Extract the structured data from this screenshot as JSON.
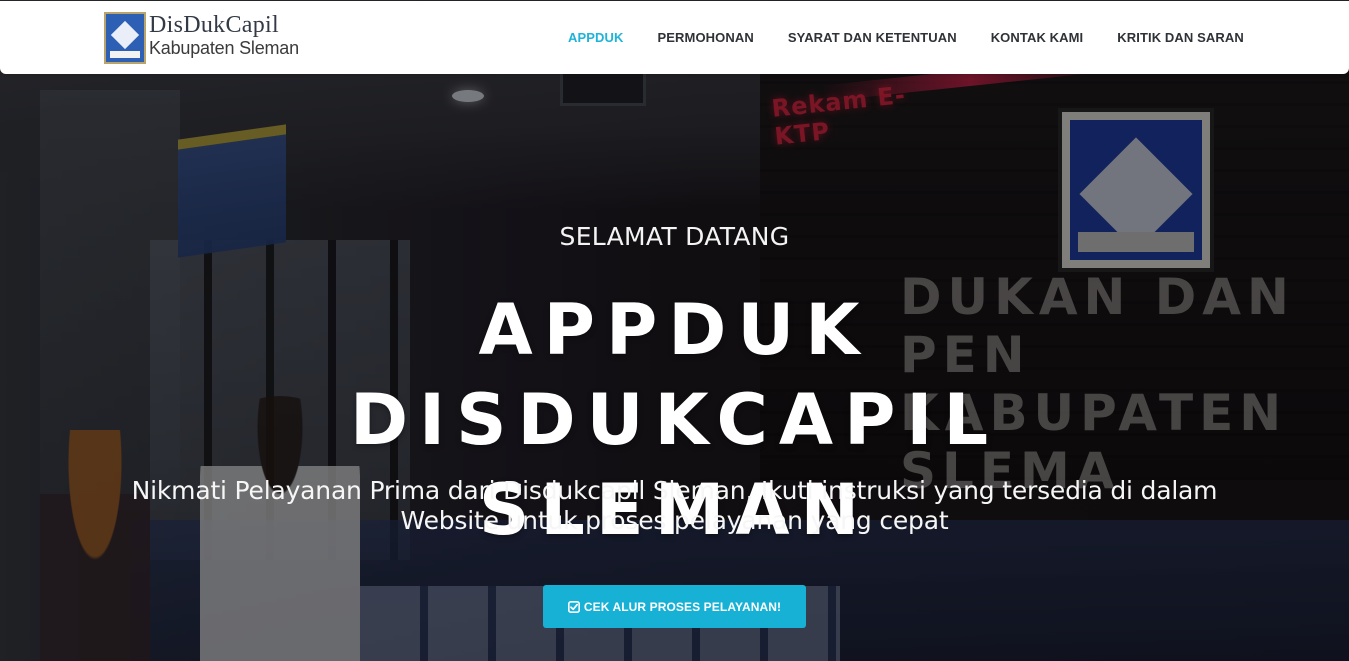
{
  "brand": {
    "title": "DisDukCapil",
    "subtitle": "Kabupaten Sleman"
  },
  "nav": {
    "items": [
      {
        "label": "APPDUK",
        "active": true
      },
      {
        "label": "PERMOHONAN",
        "active": false
      },
      {
        "label": "SYARAT DAN KETENTUAN",
        "active": false
      },
      {
        "label": "KONTAK KAMI",
        "active": false
      },
      {
        "label": "KRITIK DAN SARAN",
        "active": false
      }
    ]
  },
  "hero": {
    "welcome": "SELAMAT DATANG",
    "headline_line1": "APPDUK DISDUKCAPIL",
    "headline_line2": "SLEMAN",
    "tagline_line1": "Nikmati Pelayanan Prima dari Disdukcapil Sleman, Ikuti instruksi yang tersedia di dalam",
    "tagline_line2": "Website untuk proses pelayanan yang cepat",
    "cta_label": "CEK ALUR PROSES PELAYANAN!",
    "cta_icon": "check-square-icon",
    "background_sign": "Rekam E-KTP",
    "background_wall_line1": "DUKAN DAN PEN",
    "background_wall_line2": "KABUPATEN SLEMA"
  },
  "colors": {
    "accent": "#17b1d6",
    "nav_active": "#1fb3d8",
    "nav_text": "#2f3237",
    "navbar_bg": "#ffffff"
  }
}
